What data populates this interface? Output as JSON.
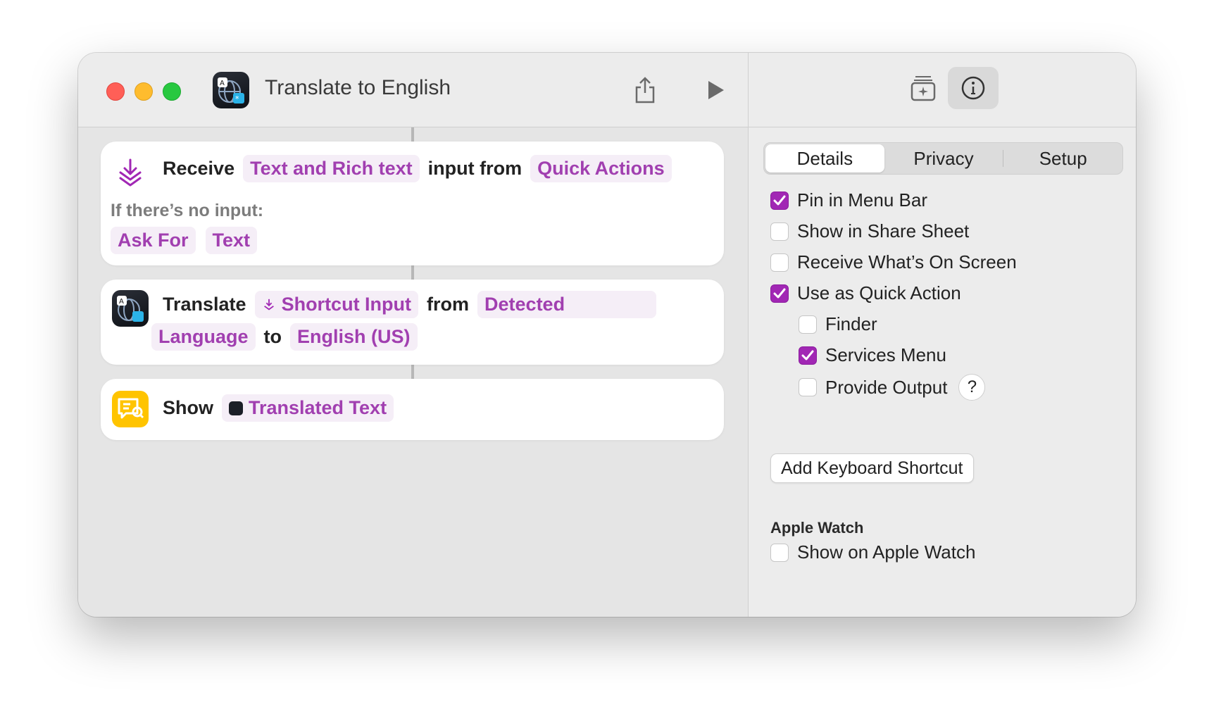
{
  "window": {
    "title": "Translate to English"
  },
  "actions": {
    "receive": {
      "verb": "Receive",
      "input_types": "Text and Rich text",
      "connector": "input from",
      "source": "Quick Actions",
      "no_input_label": "If there’s no input:",
      "fallback_action": "Ask For",
      "fallback_type": "Text"
    },
    "translate": {
      "verb": "Translate",
      "input": "Shortcut Input",
      "from_label": "from",
      "from_value_1": "Detected",
      "from_value_2": "Language",
      "to_label": "to",
      "to_value": "English (US)"
    },
    "show": {
      "verb": "Show",
      "value": "Translated Text"
    }
  },
  "sidebar": {
    "tabs": [
      {
        "label": "Details",
        "active": true
      },
      {
        "label": "Privacy",
        "active": false
      },
      {
        "label": "Setup",
        "active": false
      }
    ],
    "options": [
      {
        "label": "Pin in Menu Bar",
        "checked": true
      },
      {
        "label": "Show in Share Sheet",
        "checked": false
      },
      {
        "label": "Receive What’s On Screen",
        "checked": false
      },
      {
        "label": "Use as Quick Action",
        "checked": true
      },
      {
        "label": "Finder",
        "checked": false
      },
      {
        "label": "Services Menu",
        "checked": true
      },
      {
        "label": "Provide Output",
        "checked": false
      }
    ],
    "help_label": "?",
    "keyboard_shortcut_label": "Add Keyboard Shortcut",
    "apple_watch": {
      "heading": "Apple Watch",
      "option": {
        "label": "Show on Apple Watch",
        "checked": false
      }
    }
  },
  "colors": {
    "accent": "#a127b4",
    "token_text": "#a13fb0",
    "show_icon": "#ffc400"
  }
}
